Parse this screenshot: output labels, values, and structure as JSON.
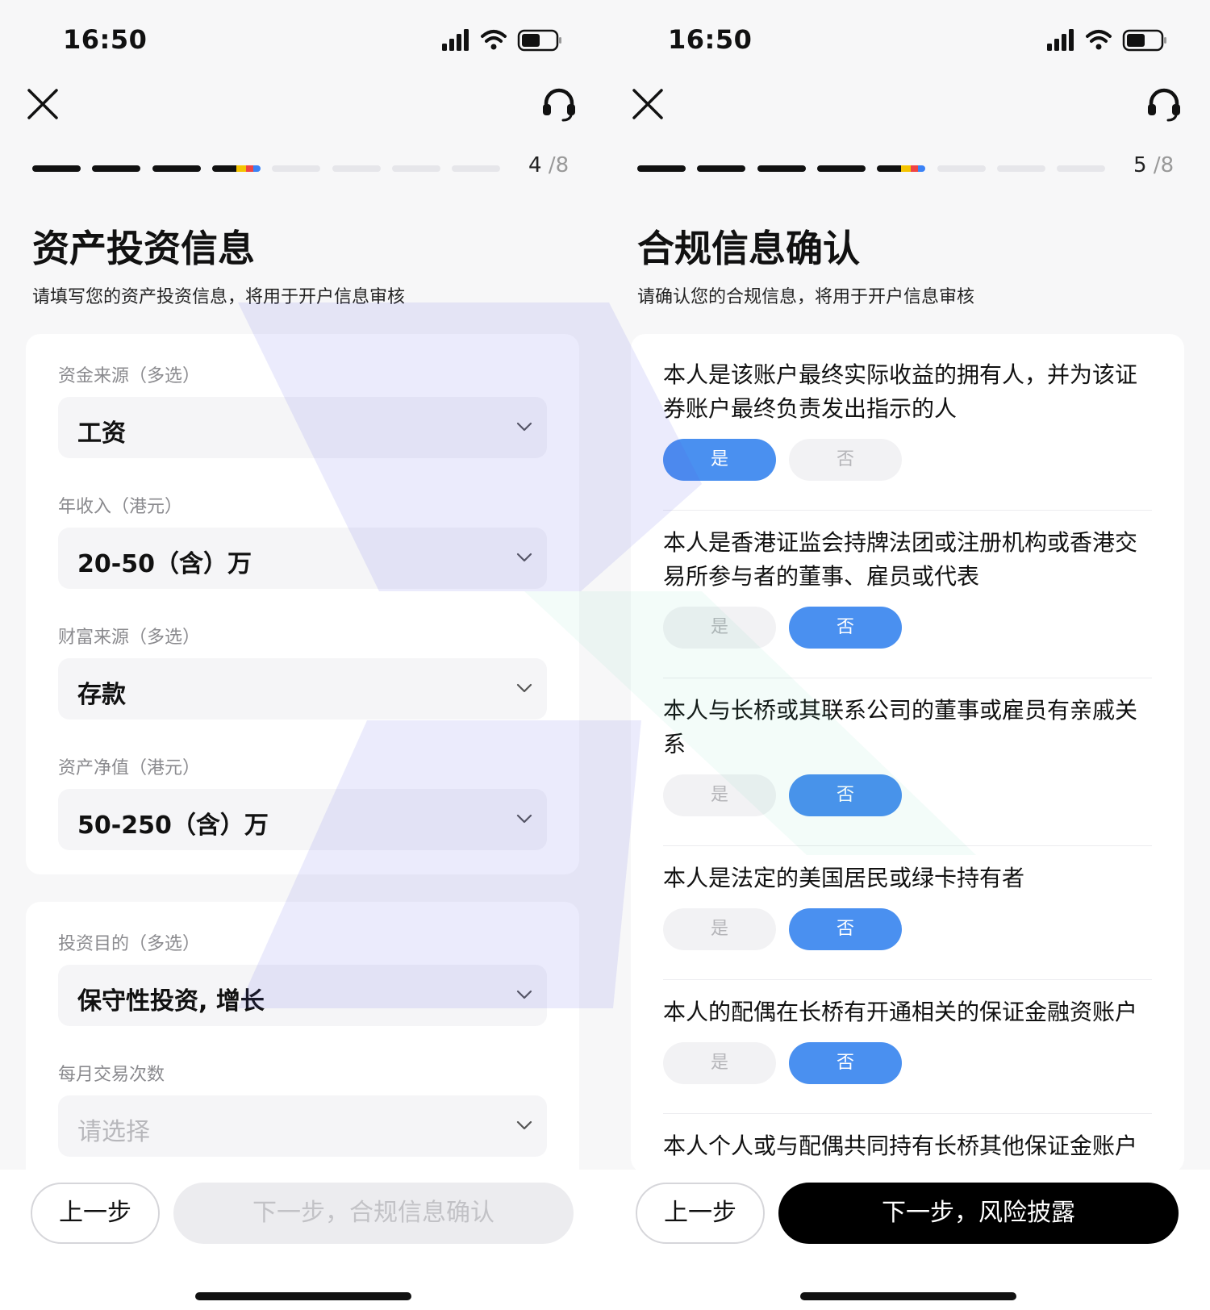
{
  "status_bar": {
    "time": "16:50"
  },
  "left": {
    "progress": {
      "current": "4",
      "total": "/8",
      "completed_steps": 3,
      "total_steps": 8
    },
    "title": "资产投资信息",
    "subtitle": "请填写您的资产投资信息，将用于开户信息审核",
    "fields_group1": [
      {
        "label": "资金来源（多选）",
        "value": "工资"
      },
      {
        "label": "年收入（港元）",
        "value": "20-50（含）万"
      },
      {
        "label": "财富来源（多选）",
        "value": "存款"
      },
      {
        "label": "资产净值（港元）",
        "value": "50-250（含）万"
      }
    ],
    "fields_group2": [
      {
        "label": "投资目的（多选）",
        "value": "保守性投资, 增长"
      },
      {
        "label": "每月交易次数",
        "placeholder": "请选择"
      }
    ],
    "back_label": "上一步",
    "next_label": "下一步，合规信息确认"
  },
  "right": {
    "progress": {
      "current": "5",
      "total": "/8",
      "completed_steps": 4,
      "total_steps": 8
    },
    "title": "合规信息确认",
    "subtitle": "请确认您的合规信息，将用于开户信息审核",
    "yes_label": "是",
    "no_label": "否",
    "questions": [
      {
        "text": "本人是该账户最终实际收益的拥有人，并为该证券账户最终负责发出指示的人",
        "answer": "yes"
      },
      {
        "text": "本人是香港证监会持牌法团或注册机构或香港交易所参与者的董事、雇员或代表",
        "answer": "no"
      },
      {
        "text": "本人与长桥或其联系公司的董事或雇员有亲戚关系",
        "answer": "no"
      },
      {
        "text": "本人是法定的美国居民或绿卡持有者",
        "answer": "no"
      },
      {
        "text": "本人的配偶在长桥有开通相关的保证金融资账户",
        "answer": "no"
      },
      {
        "text": "本人个人或与配偶共同持有长桥其他保证金账户",
        "answer": ""
      }
    ],
    "back_label": "上一步",
    "next_label": "下一步，风险披露"
  },
  "colors": {
    "accent_blue": "#4a90f0",
    "progress_done": "#111111",
    "progress_todo": "#e6e6ea",
    "progress_yellow": "#f5c400",
    "progress_red": "#ef4444",
    "progress_blue": "#3b82f6"
  }
}
